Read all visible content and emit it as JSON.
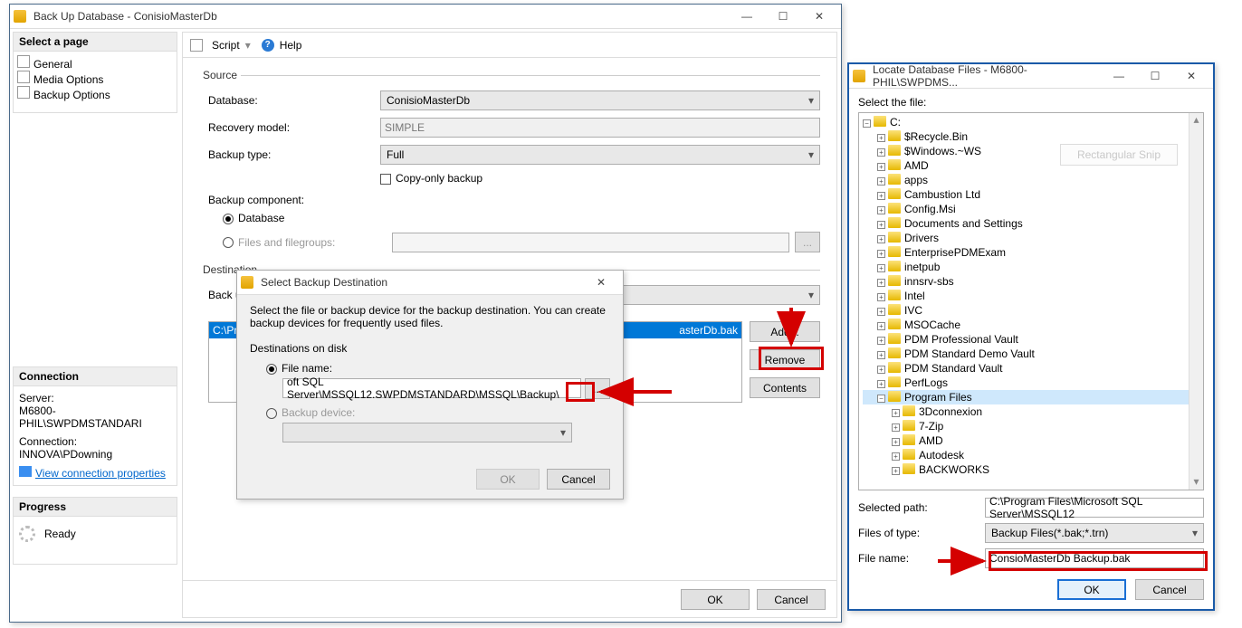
{
  "main_window": {
    "title": "Back Up Database - ConisioMasterDb",
    "left_header": "Select a page",
    "pages": [
      "General",
      "Media Options",
      "Backup Options"
    ],
    "toolbar": {
      "script": "Script",
      "help": "Help"
    },
    "source": {
      "legend": "Source",
      "db_label": "Database:",
      "db_value": "ConisioMasterDb",
      "recovery_label": "Recovery model:",
      "recovery_value": "SIMPLE",
      "type_label": "Backup type:",
      "type_value": "Full",
      "copy_only": "Copy-only backup",
      "component_label": "Backup component:",
      "opt_database": "Database",
      "opt_filegroups": "Files and filegroups:"
    },
    "dest": {
      "legend": "Destination",
      "backup_to": "Back up",
      "path_text": "C:\\Program",
      "path_tail": "asterDb.bak",
      "add": "Add...",
      "remove": "Remove",
      "contents": "Contents"
    },
    "conn": {
      "header": "Connection",
      "server_label": "Server:",
      "server": "M6800-PHIL\\SWPDMSTANDARI",
      "connection_label": "Connection:",
      "connection": "INNOVA\\PDowning",
      "view_props": "View connection properties"
    },
    "progress": {
      "header": "Progress",
      "status": "Ready"
    },
    "ok": "OK",
    "cancel": "Cancel"
  },
  "dest_dialog": {
    "title": "Select Backup Destination",
    "intro": "Select the file or backup device for the backup destination. You can create backup devices for frequently used files.",
    "group": "Destinations on disk",
    "opt_filename": "File name:",
    "filename_value": "oft SQL Server\\MSSQL12.SWPDMSTANDARD\\MSSQL\\Backup\\",
    "browse": "...",
    "opt_device": "Backup device:",
    "ok": "OK",
    "cancel": "Cancel"
  },
  "locate": {
    "title": "Locate Database Files - M6800-PHIL\\SWPDMS...",
    "select_file": "Select the file:",
    "root": "C:",
    "folders": [
      "$Recycle.Bin",
      "$Windows.~WS",
      "AMD",
      "apps",
      "Cambustion Ltd",
      "Config.Msi",
      "Documents and Settings",
      "Drivers",
      "EnterprisePDMExam",
      "inetpub",
      "innsrv-sbs",
      "Intel",
      "IVC",
      "MSOCache",
      "PDM Professional Vault",
      "PDM Standard Demo Vault",
      "PDM Standard Vault",
      "PerfLogs"
    ],
    "program_files": "Program Files",
    "pf_sub": [
      "3Dconnexion",
      "7-Zip",
      "AMD",
      "Autodesk",
      "BACKWORKS"
    ],
    "snip": "Rectangular Snip",
    "selected_path_label": "Selected path:",
    "selected_path": "C:\\Program Files\\Microsoft SQL Server\\MSSQL12",
    "filetype_label": "Files of type:",
    "filetype": "Backup Files(*.bak;*.trn)",
    "filename_label": "File name:",
    "filename": "ConsioMasterDb Backup.bak",
    "ok": "OK",
    "cancel": "Cancel"
  }
}
